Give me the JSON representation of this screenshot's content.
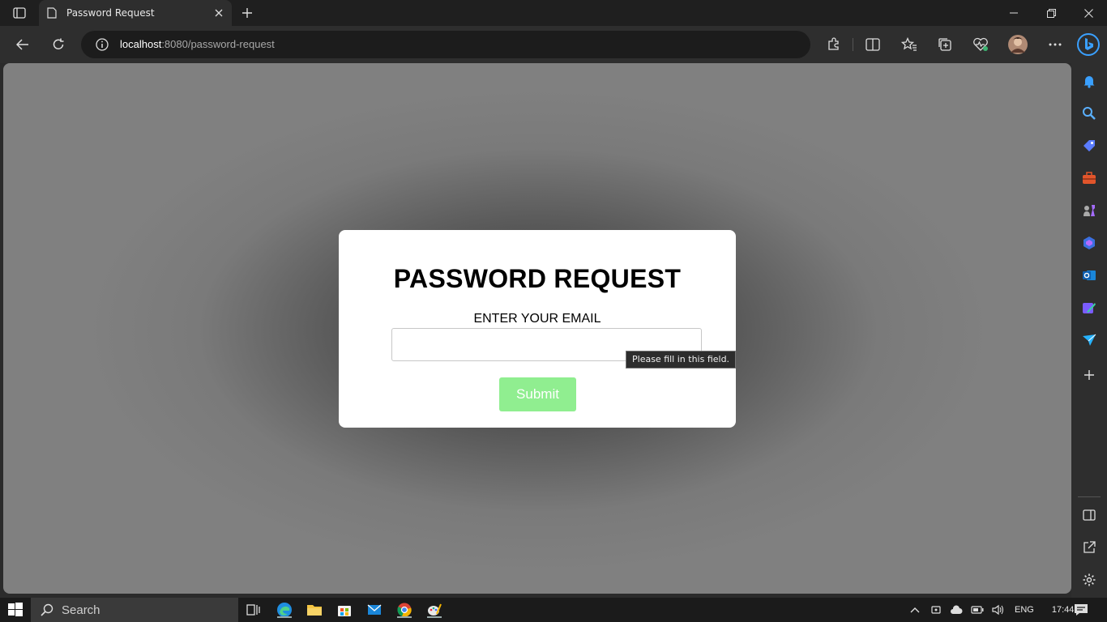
{
  "browser": {
    "tab_title": "Password Request",
    "url_host": "localhost",
    "url_rest": ":8080/password-request"
  },
  "form": {
    "title": "PASSWORD REQUEST",
    "email_label": "ENTER YOUR EMAIL",
    "email_value": "",
    "submit_label": "Submit",
    "validation_tooltip": "Please fill in this field."
  },
  "taskbar": {
    "search_placeholder": "Search",
    "language": "ENG",
    "time": "17:44"
  },
  "colors": {
    "submit_bg": "#90ee90",
    "edge_accent": "#3aa0ff"
  }
}
